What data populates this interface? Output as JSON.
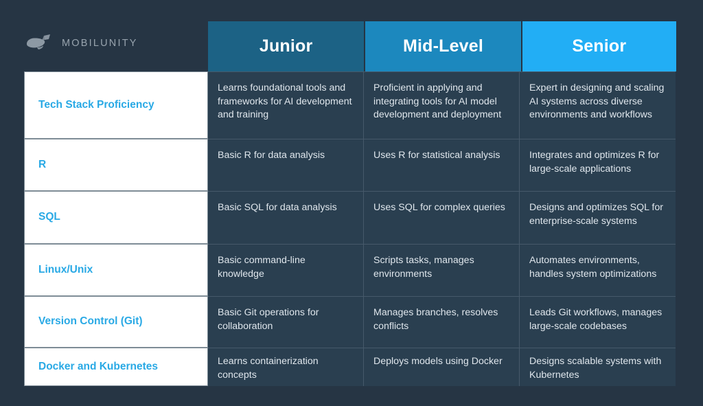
{
  "brand": {
    "logo_icon": "whale-icon",
    "name": "MOBILUNITY"
  },
  "colors": {
    "page_background": "#263544",
    "header_junior": "#1C6285",
    "header_mid": "#1C88BE",
    "header_senior": "#22AEF5",
    "label_cell_background": "#FFFFFF",
    "label_text": "#29A9E5",
    "description_cell_background": "#2A3F50",
    "description_text": "#DFE6EC"
  },
  "table": {
    "columns": [
      {
        "key": "skill",
        "label": ""
      },
      {
        "key": "junior",
        "label": "Junior"
      },
      {
        "key": "mid",
        "label": "Mid-Level"
      },
      {
        "key": "senior",
        "label": "Senior"
      }
    ],
    "rows": [
      {
        "skill": "Tech Stack Proficiency",
        "junior": "Learns foundational tools and frameworks for AI development and training",
        "mid": "Proficient in applying and integrating tools for AI model development and deployment",
        "senior": "Expert in designing and scaling AI systems across diverse environments and workflows"
      },
      {
        "skill": "R",
        "junior": "Basic R for data analysis",
        "mid": "Uses R for statistical analysis",
        "senior": "Integrates and optimizes R for large-scale applications"
      },
      {
        "skill": "SQL",
        "junior": "Basic SQL for data analysis",
        "mid": "Uses SQL for complex queries",
        "senior": "Designs and optimizes SQL for enterprise-scale systems"
      },
      {
        "skill": "Linux/Unix",
        "junior": "Basic command-line knowledge",
        "mid": "Scripts tasks, manages environments",
        "senior": "Automates environments, handles system optimizations"
      },
      {
        "skill": "Version Control (Git)",
        "junior": "Basic Git operations for collaboration",
        "mid": "Manages branches, resolves conflicts",
        "senior": "Leads Git workflows, manages large-scale codebases"
      },
      {
        "skill": "Docker and Kubernetes",
        "junior": "Learns containerization concepts",
        "mid": "Deploys models using Docker",
        "senior": "Designs scalable systems with Kubernetes"
      }
    ]
  }
}
